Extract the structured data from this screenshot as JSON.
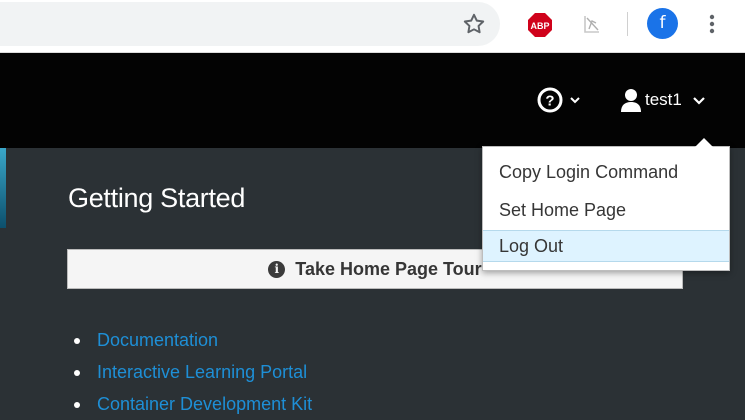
{
  "browser": {
    "icons": [
      "star-icon",
      "adblock-icon",
      "extension-icon",
      "profile-icon",
      "menu-icon"
    ],
    "adblock_label": "ABP",
    "profile_initial": "f"
  },
  "header": {
    "help_icon": "question-circle-icon",
    "user": {
      "name": "test1",
      "icon": "user-icon"
    }
  },
  "user_menu": {
    "items": [
      {
        "label": "Copy Login Command"
      },
      {
        "label": "Set Home Page"
      },
      {
        "label": "Log Out",
        "active": true
      }
    ]
  },
  "main": {
    "title": "Getting Started",
    "tour_button": "Take Home Page Tour",
    "links": [
      "Documentation",
      "Interactive Learning Portal",
      "Container Development Kit"
    ]
  },
  "colors": {
    "header_bg": "#030303",
    "content_bg": "#2b3135",
    "link": "#1e8fd6",
    "menu_active": "#def3ff",
    "abp_red": "#d0021b",
    "profile_blue": "#1a73e8"
  }
}
